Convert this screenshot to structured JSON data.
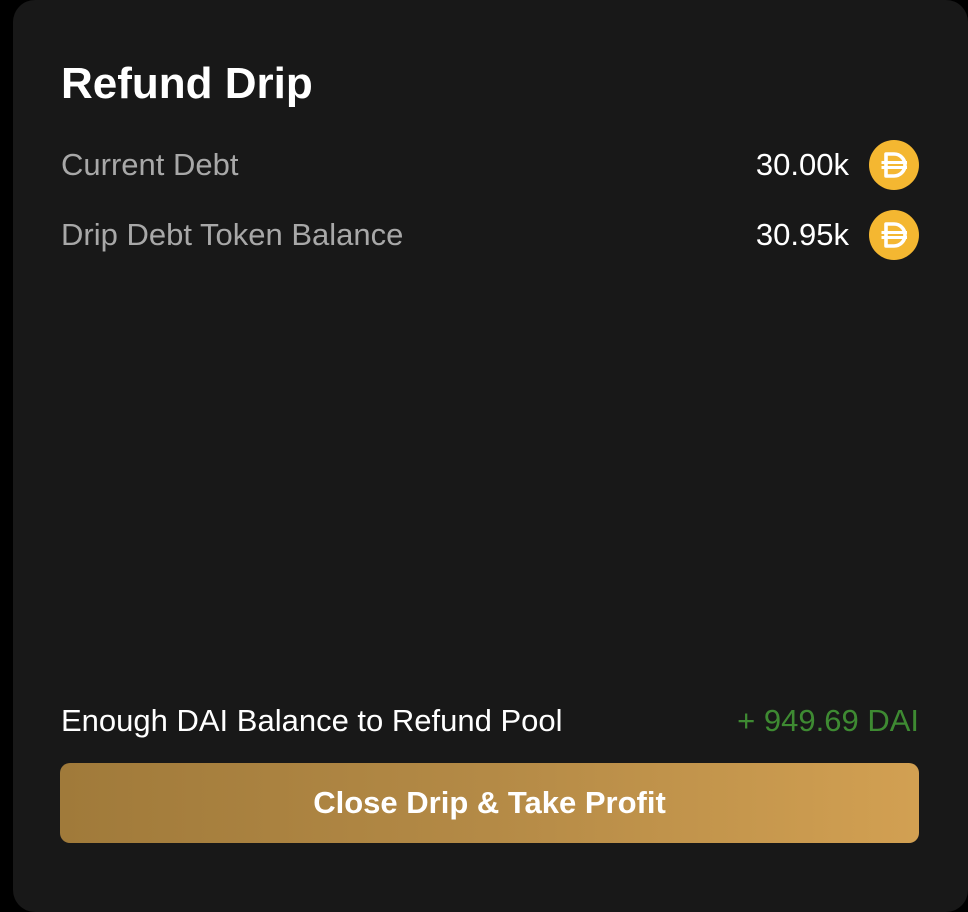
{
  "panel": {
    "title": "Refund Drip",
    "rows": [
      {
        "label": "Current Debt",
        "value": "30.00k",
        "icon": "dai-icon"
      },
      {
        "label": "Drip Debt Token Balance",
        "value": "30.95k",
        "icon": "dai-icon"
      }
    ],
    "summary": {
      "label": "Enough DAI Balance to Refund Pool",
      "value": "+ 949.69 DAI"
    },
    "action_label": "Close Drip & Take Profit"
  },
  "colors": {
    "background": "#181818",
    "label_text": "#a8a8a8",
    "positive": "#3e8a32",
    "dai_token": "#f4b731",
    "button_gradient_start": "#a07a3a",
    "button_gradient_end": "#d2a052"
  }
}
